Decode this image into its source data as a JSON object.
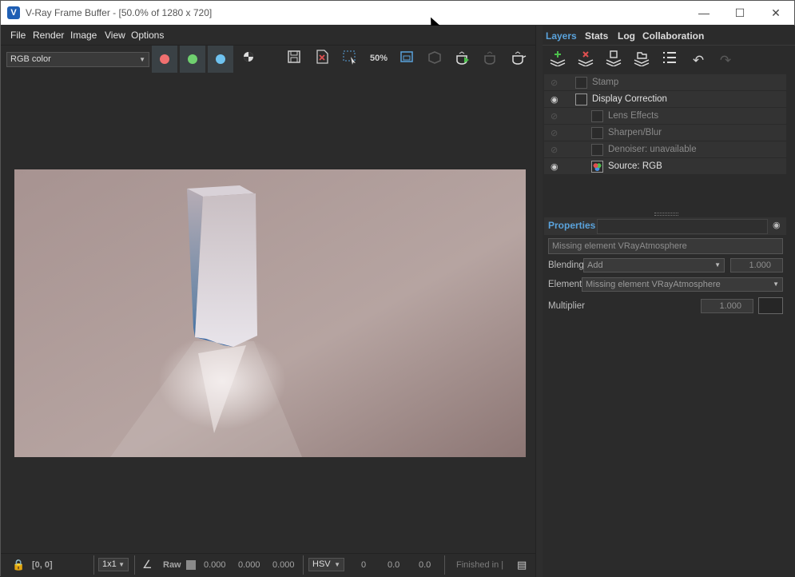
{
  "window": {
    "title": "V-Ray Frame Buffer - [50.0% of 1280 x 720]",
    "app_icon": "V"
  },
  "menu": [
    "File",
    "Render",
    "Image",
    "View",
    "Options"
  ],
  "toolbar": {
    "channel_select": "RGB color",
    "save_icon": "save-icon",
    "zoom_label": "50%"
  },
  "status": {
    "coords": "[0, 0]",
    "sample": "1x1",
    "raw_label": "Raw",
    "r": "0.000",
    "g": "0.000",
    "b": "0.000",
    "color_mode": "HSV",
    "h": "0",
    "s": "0.0",
    "v": "0.0",
    "render_status": "Finished in |"
  },
  "panel": {
    "tabs": [
      "Layers",
      "Stats",
      "Log",
      "Collaboration"
    ],
    "layers": [
      {
        "name": "Stamp",
        "enabled": false,
        "indent": 0
      },
      {
        "name": "Display Correction",
        "enabled": true,
        "indent": 0
      },
      {
        "name": "Lens Effects",
        "enabled": false,
        "indent": 1
      },
      {
        "name": "Sharpen/Blur",
        "enabled": false,
        "indent": 1
      },
      {
        "name": "Denoiser: unavailable",
        "enabled": false,
        "indent": 1
      },
      {
        "name": "Source: RGB",
        "enabled": true,
        "indent": 1
      }
    ],
    "properties_title": "Properties",
    "element_name": "Missing element VRayAtmosphere",
    "blending_label": "Blending",
    "blending_value": "Add",
    "blending_amount": "1.000",
    "element_label": "Element",
    "element_value": "Missing element VRayAtmosphere",
    "multiplier_label": "Multiplier",
    "multiplier_value": "1.000"
  },
  "colors": {
    "accent": "#5aa3dc",
    "red_channel": "#f07070",
    "green_channel": "#6fd06f",
    "blue_channel": "#6fc3f0"
  }
}
